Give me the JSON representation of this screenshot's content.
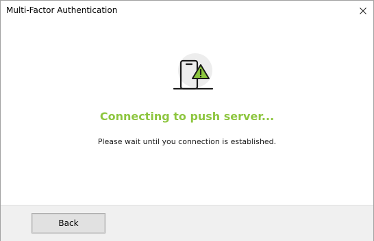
{
  "window": {
    "title": "Multi-Factor Authentication"
  },
  "main": {
    "illustration_icon": "phone-with-warning-icon",
    "headline": "Connecting to push server...",
    "message": "Please wait until you connection is established."
  },
  "footer": {
    "back_label": "Back"
  },
  "colors": {
    "accent": "#8dc63f",
    "footer_bg": "#f0f0f0",
    "button_bg": "#e1e1e1"
  }
}
